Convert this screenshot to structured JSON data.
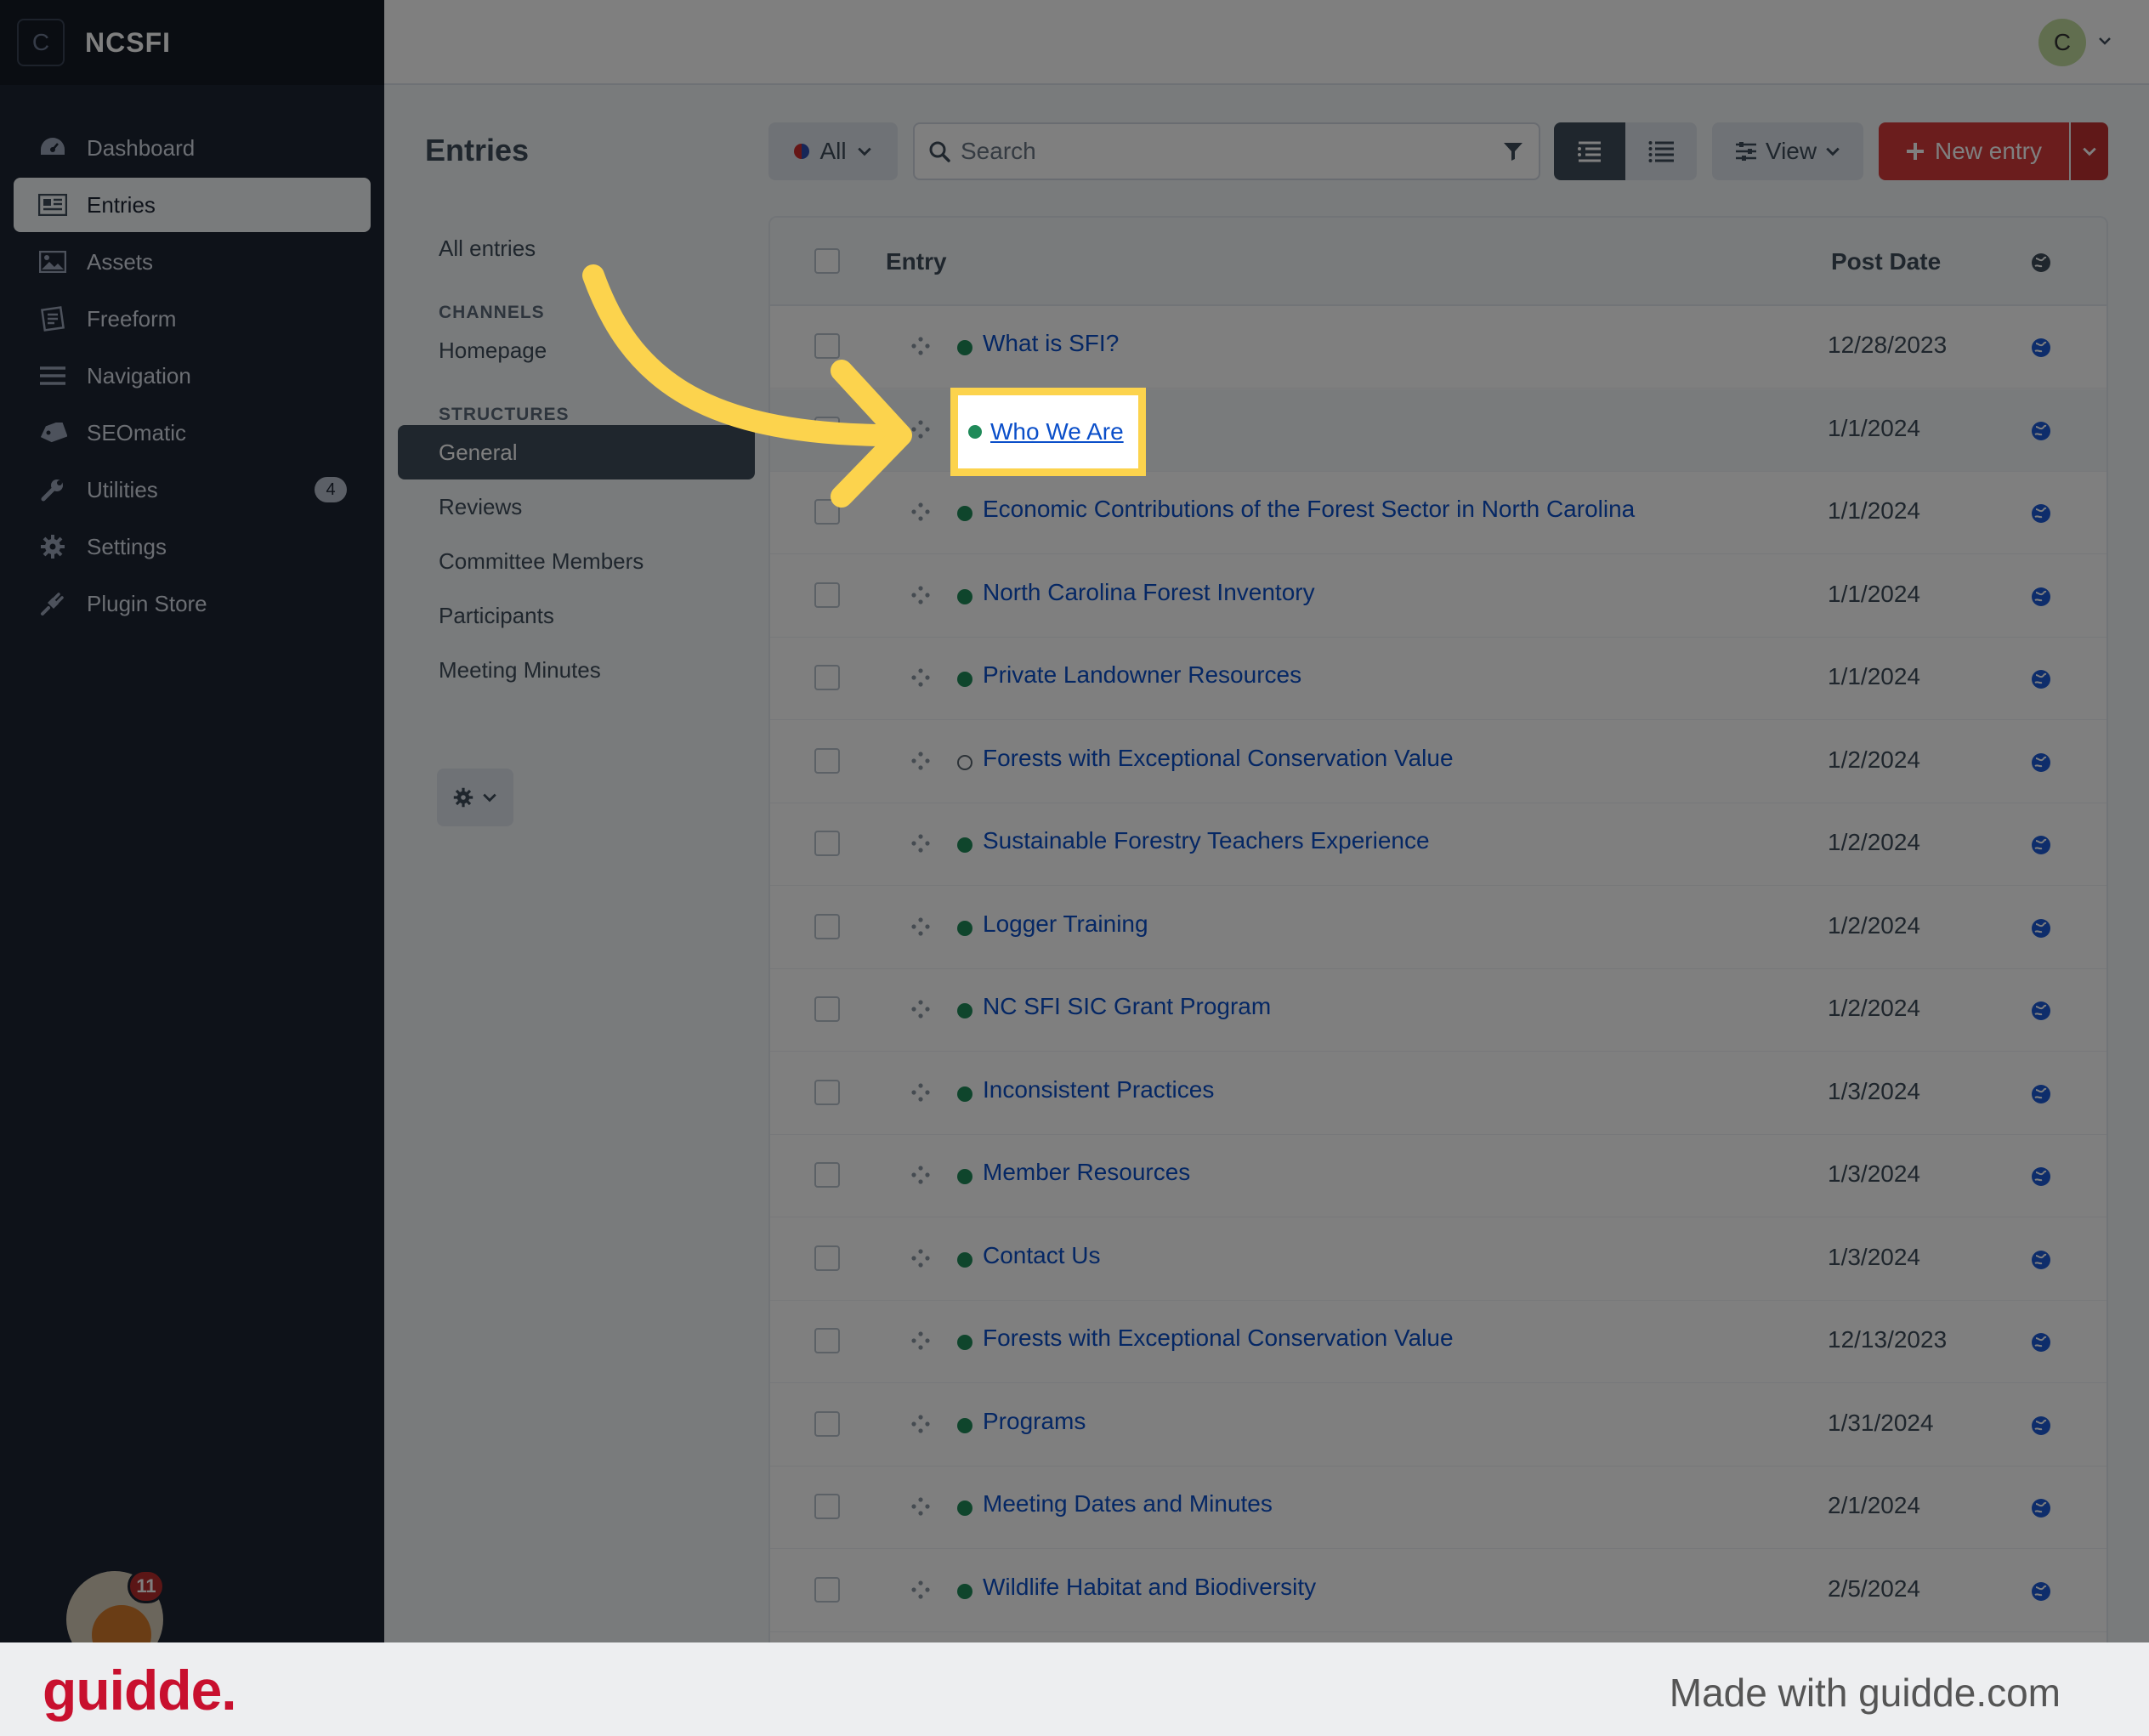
{
  "brand": {
    "initial": "C",
    "name": "NCSFI"
  },
  "sidebar": {
    "items": [
      {
        "label": "Dashboard",
        "icon": "dashboard-gauge-icon"
      },
      {
        "label": "Entries",
        "icon": "newspaper-icon",
        "active": true
      },
      {
        "label": "Assets",
        "icon": "image-icon"
      },
      {
        "label": "Freeform",
        "icon": "form-icon"
      },
      {
        "label": "Navigation",
        "icon": "bars-icon"
      },
      {
        "label": "SEOmatic",
        "icon": "seo-tag-icon"
      },
      {
        "label": "Utilities",
        "icon": "wrench-icon",
        "badge": "4"
      },
      {
        "label": "Settings",
        "icon": "gear-icon"
      },
      {
        "label": "Plugin Store",
        "icon": "plug-icon"
      }
    ],
    "notification_count": "11"
  },
  "topbar": {
    "user_initial": "C"
  },
  "page": {
    "title": "Entries"
  },
  "sources": {
    "all_entries": "All entries",
    "channels_heading": "CHANNELS",
    "channels": [
      "Homepage"
    ],
    "structures_heading": "STRUCTURES",
    "structures": [
      "General",
      "Reviews",
      "Committee Members",
      "Participants",
      "Meeting Minutes"
    ],
    "active": "General"
  },
  "toolbar": {
    "site_filter": "All",
    "search_placeholder": "Search",
    "view_label": "View",
    "new_entry_label": "New entry"
  },
  "table": {
    "columns": [
      "Entry",
      "Post Date"
    ],
    "rows": [
      {
        "title": "What is SFI?",
        "date": "12/28/2023",
        "status": "live"
      },
      {
        "title": "Who We Are",
        "date": "1/1/2024",
        "status": "live",
        "highlighted": true
      },
      {
        "title": "Economic Contributions of the Forest Sector in North Carolina",
        "date": "1/1/2024",
        "status": "live"
      },
      {
        "title": "North Carolina Forest Inventory",
        "date": "1/1/2024",
        "status": "live"
      },
      {
        "title": "Private Landowner Resources",
        "date": "1/1/2024",
        "status": "live"
      },
      {
        "title": "Forests with Exceptional Conservation Value",
        "date": "1/2/2024",
        "status": "disabled"
      },
      {
        "title": "Sustainable Forestry Teachers Experience",
        "date": "1/2/2024",
        "status": "live"
      },
      {
        "title": "Logger Training",
        "date": "1/2/2024",
        "status": "live"
      },
      {
        "title": "NC SFI SIC Grant Program",
        "date": "1/2/2024",
        "status": "live"
      },
      {
        "title": "Inconsistent Practices",
        "date": "1/3/2024",
        "status": "live"
      },
      {
        "title": "Member Resources",
        "date": "1/3/2024",
        "status": "live"
      },
      {
        "title": "Contact Us",
        "date": "1/3/2024",
        "status": "live"
      },
      {
        "title": "Forests with Exceptional Conservation Value",
        "date": "12/13/2023",
        "status": "live"
      },
      {
        "title": "Programs",
        "date": "1/31/2024",
        "status": "live"
      },
      {
        "title": "Meeting Dates and Minutes",
        "date": "2/1/2024",
        "status": "live"
      },
      {
        "title": "Wildlife Habitat and Biodiversity",
        "date": "2/5/2024",
        "status": "live"
      }
    ]
  },
  "colors": {
    "accent": "#d63b3b",
    "highlight": "#fcd34d",
    "link": "#0b4fc9",
    "live": "#1f8a59",
    "sidebar": "#1d2433"
  },
  "footer": {
    "logo": "guidde.",
    "made_with": "Made with guidde.com"
  }
}
